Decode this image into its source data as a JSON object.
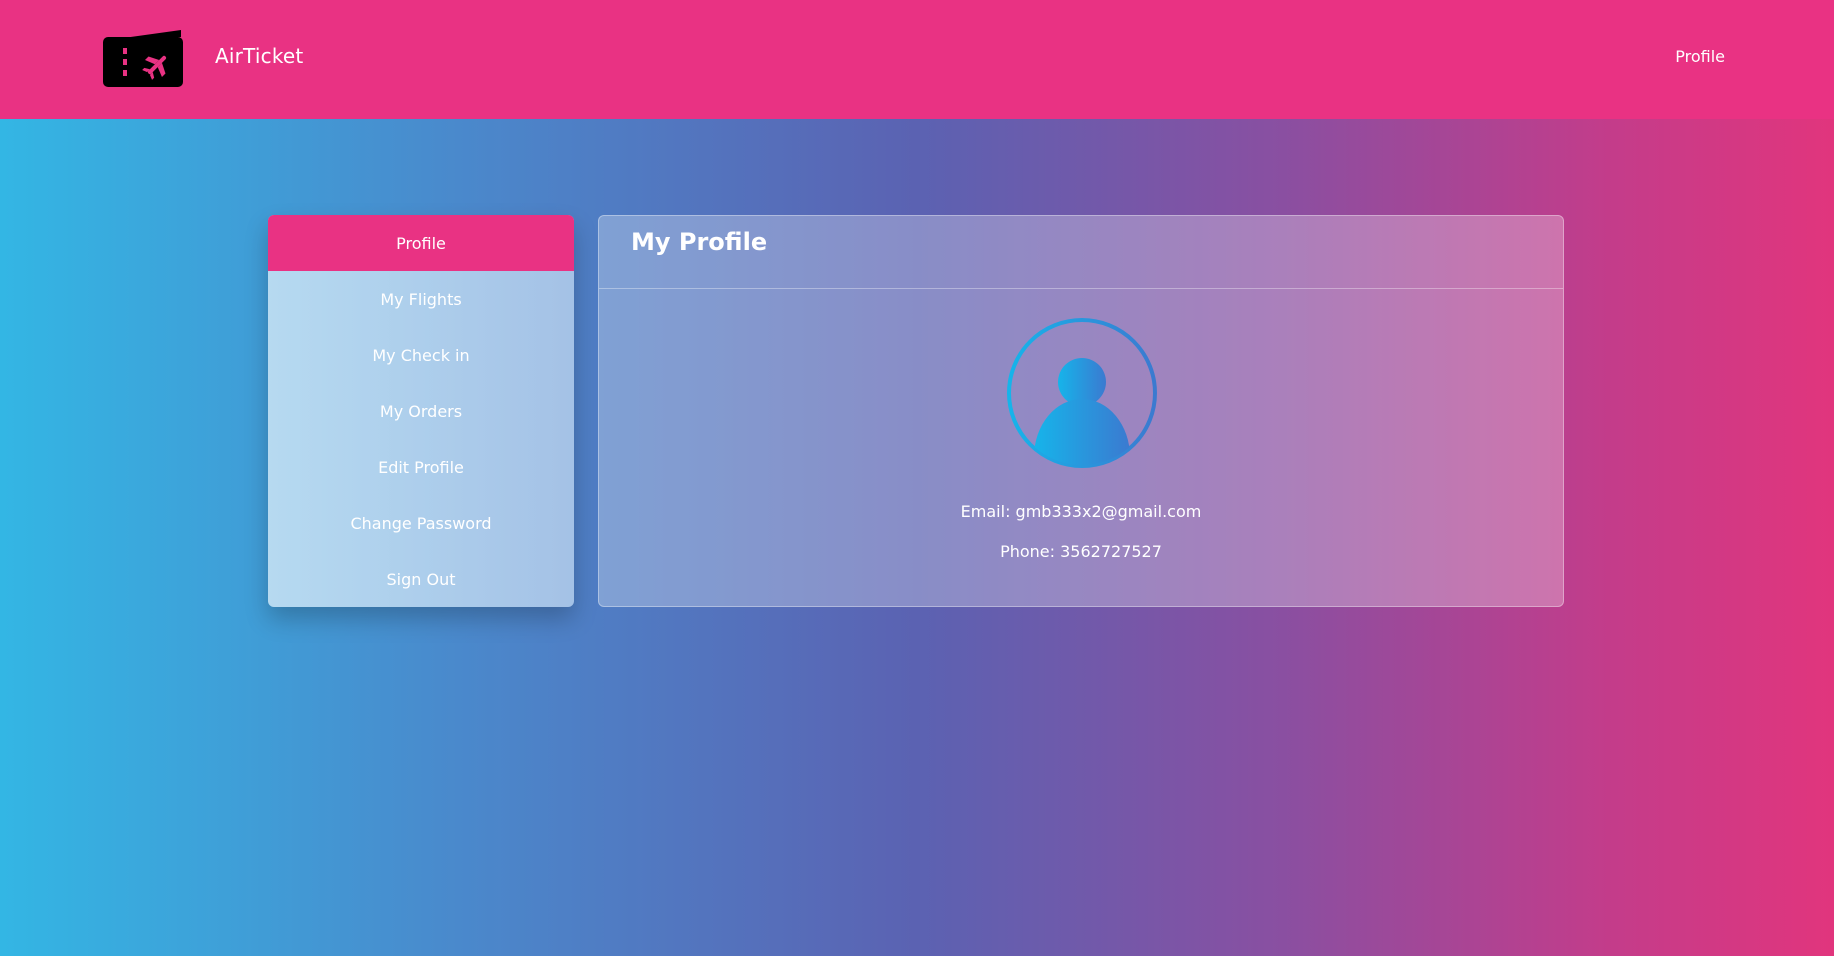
{
  "navbar": {
    "brand": "AirTicket",
    "profile_link": "Profile",
    "logo_icon": "ticket-plane-icon"
  },
  "sidebar": {
    "items": [
      {
        "label": "Profile",
        "active": true
      },
      {
        "label": "My Flights",
        "active": false
      },
      {
        "label": "My Check in",
        "active": false
      },
      {
        "label": "My Orders",
        "active": false
      },
      {
        "label": "Edit Profile",
        "active": false
      },
      {
        "label": "Change Password",
        "active": false
      },
      {
        "label": "Sign Out",
        "active": false
      }
    ]
  },
  "profile": {
    "title": "My Profile",
    "avatar_icon": "user-avatar-icon",
    "email_line": "Email: gmb333x2@gmail.com",
    "phone_line": "Phone: 3562727527"
  },
  "colors": {
    "accent": "#e93283",
    "gradient_start": "#33b6e4",
    "gradient_mid": "#5b62b2",
    "gradient_end": "#e1357d"
  }
}
